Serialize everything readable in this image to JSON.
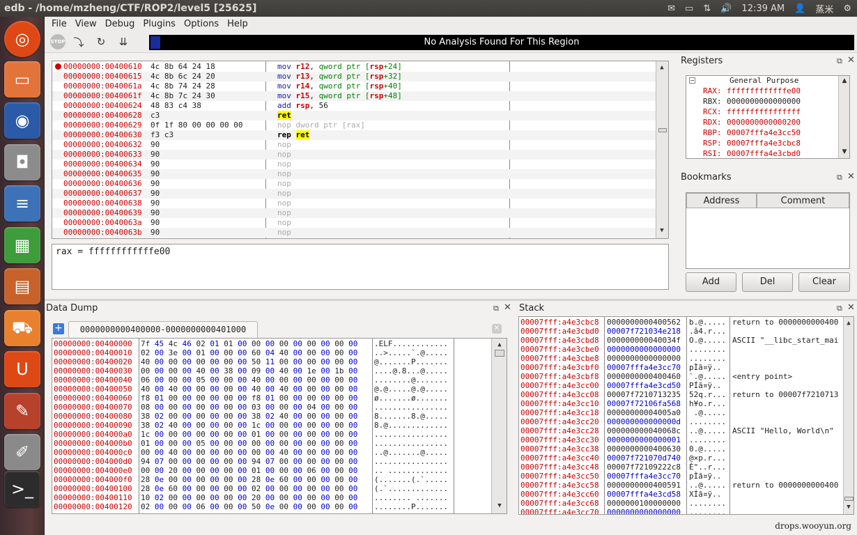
{
  "window": {
    "title": "edb - /home/mzheng/CTF/ROP2/level5 [25625]"
  },
  "tray": {
    "clock": "12:39 AM",
    "user": "蒸米"
  },
  "menu": [
    "File",
    "View",
    "Debug",
    "Plugins",
    "Options",
    "Help"
  ],
  "analysis": {
    "text": "No Analysis Found For This Region"
  },
  "cpu_rows": [
    {
      "addr": "00000000:00400610",
      "bytes": "4c 8b 64 24 18",
      "mn": "mov",
      "ops": [
        [
          "reg",
          "r12"
        ],
        [
          "plain",
          ", "
        ],
        [
          "kw",
          "qword ptr ["
        ],
        [
          "reg",
          "rsp"
        ],
        [
          "kw",
          "+24]"
        ]
      ],
      "bp": true
    },
    {
      "addr": "00000000:00400615",
      "bytes": "4c 8b 6c 24 20",
      "mn": "mov",
      "ops": [
        [
          "reg",
          "r13"
        ],
        [
          "plain",
          ", "
        ],
        [
          "kw",
          "qword ptr ["
        ],
        [
          "reg",
          "rsp"
        ],
        [
          "kw",
          "+32]"
        ]
      ]
    },
    {
      "addr": "00000000:0040061a",
      "bytes": "4c 8b 74 24 28",
      "mn": "mov",
      "ops": [
        [
          "reg",
          "r14"
        ],
        [
          "plain",
          ", "
        ],
        [
          "kw",
          "qword ptr ["
        ],
        [
          "reg",
          "rsp"
        ],
        [
          "kw",
          "+40]"
        ]
      ]
    },
    {
      "addr": "00000000:0040061f",
      "bytes": "4c 8b 7c 24 30",
      "mn": "mov",
      "ops": [
        [
          "reg",
          "r15"
        ],
        [
          "plain",
          ", "
        ],
        [
          "kw",
          "qword ptr ["
        ],
        [
          "reg",
          "rsp"
        ],
        [
          "kw",
          "+48]"
        ]
      ]
    },
    {
      "addr": "00000000:00400624",
      "bytes": "48 83 c4 38",
      "mn": "add",
      "ops": [
        [
          "reg",
          "rsp"
        ],
        [
          "plain",
          ", 56"
        ]
      ]
    },
    {
      "addr": "00000000:00400628",
      "bytes": "c3",
      "mn": "ret",
      "ret": true,
      "ops": []
    },
    {
      "addr": "00000000:00400629",
      "bytes": "0f 1f 80 00 00 00 00",
      "mn": "nop",
      "nop": true,
      "ops": [
        [
          "nopops",
          "dword ptr [rax]"
        ]
      ]
    },
    {
      "addr": "00000000:00400630",
      "bytes": "f3 c3",
      "mn": "rep",
      "rep": true,
      "ops": [
        [
          "retbox",
          "ret"
        ]
      ]
    },
    {
      "addr": "00000000:00400632",
      "bytes": "90",
      "mn": "nop",
      "nop": true,
      "ops": []
    },
    {
      "addr": "00000000:00400633",
      "bytes": "90",
      "mn": "nop",
      "nop": true,
      "ops": []
    },
    {
      "addr": "00000000:00400634",
      "bytes": "90",
      "mn": "nop",
      "nop": true,
      "ops": []
    },
    {
      "addr": "00000000:00400635",
      "bytes": "90",
      "mn": "nop",
      "nop": true,
      "ops": []
    },
    {
      "addr": "00000000:00400636",
      "bytes": "90",
      "mn": "nop",
      "nop": true,
      "ops": []
    },
    {
      "addr": "00000000:00400637",
      "bytes": "90",
      "mn": "nop",
      "nop": true,
      "ops": []
    },
    {
      "addr": "00000000:00400638",
      "bytes": "90",
      "mn": "nop",
      "nop": true,
      "ops": []
    },
    {
      "addr": "00000000:00400639",
      "bytes": "90",
      "mn": "nop",
      "nop": true,
      "ops": []
    },
    {
      "addr": "00000000:0040063a",
      "bytes": "90",
      "mn": "nop",
      "nop": true,
      "ops": []
    },
    {
      "addr": "00000000:0040063b",
      "bytes": "90",
      "mn": "nop",
      "nop": true,
      "ops": []
    }
  ],
  "expression": "rax = ffffffffffffe00",
  "registers": {
    "title": "Registers",
    "group": "General Purpose",
    "rows": [
      {
        "name": "RAX:",
        "value": "fffffffffffffe00",
        "changed": true
      },
      {
        "name": "RBX:",
        "value": "0000000000000000",
        "changed": false
      },
      {
        "name": "RCX:",
        "value": "ffffffffffffffff",
        "changed": true
      },
      {
        "name": "RDX:",
        "value": "0000000000000200",
        "changed": true
      },
      {
        "name": "RBP:",
        "value": "00007fffa4e3cc50",
        "changed": true
      },
      {
        "name": "RSP:",
        "value": "00007fffa4e3cbc8",
        "changed": true
      },
      {
        "name": "RSI:",
        "value": "00007fffa4e3cbd0",
        "changed": true
      }
    ]
  },
  "bookmarks": {
    "title": "Bookmarks",
    "col_address": "Address",
    "col_comment": "Comment",
    "add": "Add",
    "del": "Del",
    "clear": "Clear"
  },
  "dump": {
    "title": "Data Dump",
    "tab": "0000000000400000-0000000000401000",
    "rows": [
      {
        "a": "00000000:00400000",
        "h": "7f 45 4c 46 02 01 01 00 00 00 00 00 00 00 00 00",
        "s": ".ELF............"
      },
      {
        "a": "00000000:00400010",
        "h": "02 00 3e 00 01 00 00 00 60 04 40 00 00 00 00 00",
        "s": "..>.....`.@....."
      },
      {
        "a": "00000000:00400020",
        "h": "40 00 00 00 00 00 00 00 50 11 00 00 00 00 00 00",
        "s": "@.......P......."
      },
      {
        "a": "00000000:00400030",
        "h": "00 00 00 00 40 00 38 00 09 00 40 00 1e 00 1b 00",
        "s": "....@.8...@....."
      },
      {
        "a": "00000000:00400040",
        "h": "06 00 00 00 05 00 00 00 40 00 00 00 00 00 00 00",
        "s": "........@......."
      },
      {
        "a": "00000000:00400050",
        "h": "40 00 40 00 00 00 00 00 40 00 40 00 00 00 00 00",
        "s": "@.@.....@.@....."
      },
      {
        "a": "00000000:00400060",
        "h": "f8 01 00 00 00 00 00 00 f8 01 00 00 00 00 00 00",
        "s": "ø.......ø......."
      },
      {
        "a": "00000000:00400070",
        "h": "08 00 00 00 00 00 00 00 03 00 00 00 04 00 00 00",
        "s": "................"
      },
      {
        "a": "00000000:00400080",
        "h": "38 02 00 00 00 00 00 00 38 02 40 00 00 00 00 00",
        "s": "8.......8.@....."
      },
      {
        "a": "00000000:00400090",
        "h": "38 02 40 00 00 00 00 00 1c 00 00 00 00 00 00 00",
        "s": "8.@............."
      },
      {
        "a": "00000000:004000a0",
        "h": "1c 00 00 00 00 00 00 00 01 00 00 00 00 00 00 00",
        "s": "................"
      },
      {
        "a": "00000000:004000b0",
        "h": "01 00 00 00 05 00 00 00 00 00 00 00 00 00 00 00",
        "s": "................"
      },
      {
        "a": "00000000:004000c0",
        "h": "00 00 40 00 00 00 00 00 00 00 40 00 00 00 00 00",
        "s": "..@.......@....."
      },
      {
        "a": "00000000:004000d0",
        "h": "94 07 00 00 00 00 00 00 94 07 00 00 00 00 00 00",
        "s": "................"
      },
      {
        "a": "00000000:004000e0",
        "h": "00 00 20 00 00 00 00 00 01 00 00 00 06 00 00 00",
        "s": ".. ............."
      },
      {
        "a": "00000000:004000f0",
        "h": "28 0e 00 00 00 00 00 00 28 0e 60 00 00 00 00 00",
        "s": "(.......(.`....."
      },
      {
        "a": "00000000:00400100",
        "h": "28 0e 60 00 00 00 00 00 02 00 00 00 00 00 00 00",
        "s": "(.`............."
      },
      {
        "a": "00000000:00400110",
        "h": "10 02 00 00 00 00 00 00 20 00 00 00 00 00 00 00",
        "s": "........ ......."
      },
      {
        "a": "00000000:00400120",
        "h": "02 00 00 00 06 00 00 00 50 0e 00 00 00 00 00 00",
        "s": "........P......."
      }
    ]
  },
  "stack": {
    "title": "Stack",
    "rows": [
      {
        "a": "00007fff:a4e3cbc8",
        "v": "0000000000400562",
        "blue": false,
        "s": "b.@.....",
        "c": "return to 0000000000400"
      },
      {
        "a": "00007fff:a4e3cbd0",
        "v": "00007f721034e218",
        "blue": true,
        "s": ".â4.r...",
        "c": ""
      },
      {
        "a": "00007fff:a4e3cbd8",
        "v": "000000000040034f",
        "blue": false,
        "s": "O.@.....",
        "c": "ASCII \"__libc_start_mai"
      },
      {
        "a": "00007fff:a4e3cbe0",
        "v": "0000000000000000",
        "blue": true,
        "s": "........",
        "c": ""
      },
      {
        "a": "00007fff:a4e3cbe8",
        "v": "0000000000000000",
        "blue": false,
        "s": "........",
        "c": ""
      },
      {
        "a": "00007fff:a4e3cbf0",
        "v": "00007fffa4e3cc70",
        "blue": true,
        "s": "pÌã¤ÿ..",
        "c": ""
      },
      {
        "a": "00007fff:a4e3cbf8",
        "v": "0000000000400460",
        "blue": false,
        "s": "`.@.....",
        "c": "<entry point>"
      },
      {
        "a": "00007fff:a4e3cc00",
        "v": "00007fffa4e3cd50",
        "blue": true,
        "s": "PÍã¤ÿ..",
        "c": ""
      },
      {
        "a": "00007fff:a4e3cc08",
        "v": "00007f7210713235",
        "blue": false,
        "s": "52q.r...",
        "c": "return to 00007f7210713"
      },
      {
        "a": "00007fff:a4e3cc10",
        "v": "00007f72106fa568",
        "blue": true,
        "s": "h¥o.r...",
        "c": ""
      },
      {
        "a": "00007fff:a4e3cc18",
        "v": "00000000004005a0",
        "blue": false,
        "s": " .@.....",
        "c": ""
      },
      {
        "a": "00007fff:a4e3cc20",
        "v": "000000000000000d",
        "blue": true,
        "s": "........",
        "c": ""
      },
      {
        "a": "00007fff:a4e3cc28",
        "v": "000000000040068c",
        "blue": false,
        "s": "..@.....",
        "c": "ASCII \"Hello, World\\n\""
      },
      {
        "a": "00007fff:a4e3cc30",
        "v": "0000000000000001",
        "blue": true,
        "s": "........",
        "c": ""
      },
      {
        "a": "00007fff:a4e3cc38",
        "v": "0000000000400630",
        "blue": false,
        "s": "0.@.....",
        "c": ""
      },
      {
        "a": "00007fff:a4e3cc40",
        "v": "00007f721070d740",
        "blue": true,
        "s": "@×p.r...",
        "c": ""
      },
      {
        "a": "00007fff:a4e3cc48",
        "v": "00007f72109222c8",
        "blue": false,
        "s": "È\"..r...",
        "c": ""
      },
      {
        "a": "00007fff:a4e3cc50",
        "v": "00007fffa4e3cc70",
        "blue": true,
        "s": "pÌã¤ÿ..",
        "c": ""
      },
      {
        "a": "00007fff:a4e3cc58",
        "v": "0000000000400591",
        "blue": false,
        "s": "..@.....",
        "c": "return to 0000000000400"
      },
      {
        "a": "00007fff:a4e3cc60",
        "v": "00007fffa4e3cd58",
        "blue": true,
        "s": "XÍã¤ÿ..",
        "c": ""
      },
      {
        "a": "00007fff:a4e3cc68",
        "v": "0000000100000000",
        "blue": false,
        "s": "........",
        "c": ""
      },
      {
        "a": "00007fff:a4e3cc70",
        "v": "0000000000000000",
        "blue": true,
        "s": "........",
        "c": ""
      }
    ]
  },
  "watermark": "drops.wooyun.org",
  "colors": {
    "addr": "#cc0000",
    "blue": "#0000cc",
    "reg": "#cc0000",
    "kw": "#008000",
    "mn": "#1a1aa6",
    "highlight": "#ffff00"
  },
  "launcher_icons": [
    "ubuntu-logo-icon",
    "files-icon",
    "firefox-icon",
    "camera-icon",
    "writer-icon",
    "calc-icon",
    "impress-icon",
    "software-center-icon",
    "ubuntu-one-icon",
    "settings-icon",
    "text-editor-icon",
    "terminal-icon"
  ]
}
